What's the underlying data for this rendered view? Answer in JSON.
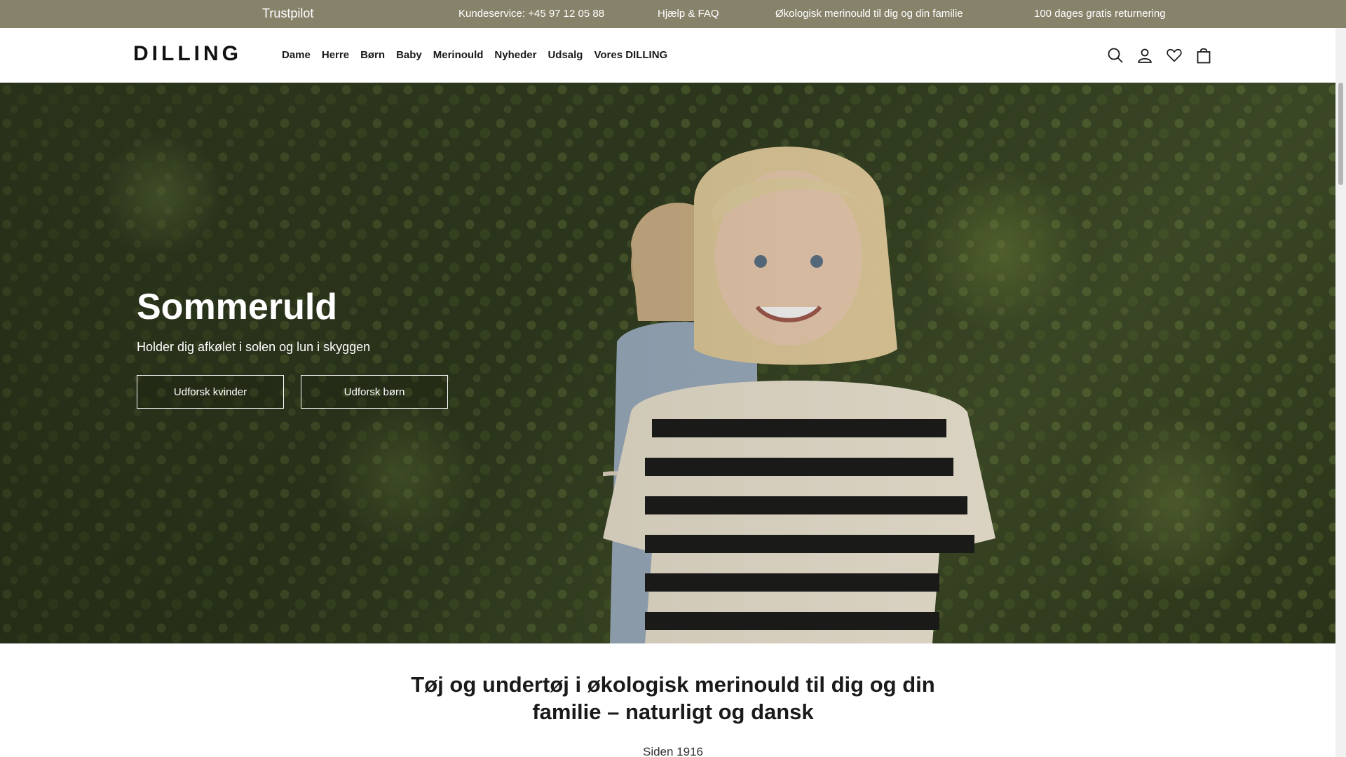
{
  "topbar": {
    "trustpilot": "Trustpilot",
    "phone": "Kundeservice: +45 97 12 05 88",
    "help": "Hjælp & FAQ",
    "eco": "Økologisk merinould til dig og din familie",
    "returns": "100 dages gratis returnering",
    "bg_color": "#87836b"
  },
  "header": {
    "logo": "DILLING",
    "nav": [
      "Dame",
      "Herre",
      "Børn",
      "Baby",
      "Merinould",
      "Nyheder",
      "Udsalg",
      "Vores DILLING"
    ],
    "icons": [
      "search-icon",
      "account-icon",
      "wishlist-icon",
      "cart-icon"
    ]
  },
  "hero": {
    "title": "Sommeruld",
    "subtitle": "Holder dig afkølet i solen og lun i skyggen",
    "button_women": "Udforsk kvinder",
    "button_kids": "Udforsk børn"
  },
  "content": {
    "heading": "Tøj og undertøj i økologisk merinould til dig og din familie – naturligt og dansk",
    "since": "Siden 1916"
  }
}
